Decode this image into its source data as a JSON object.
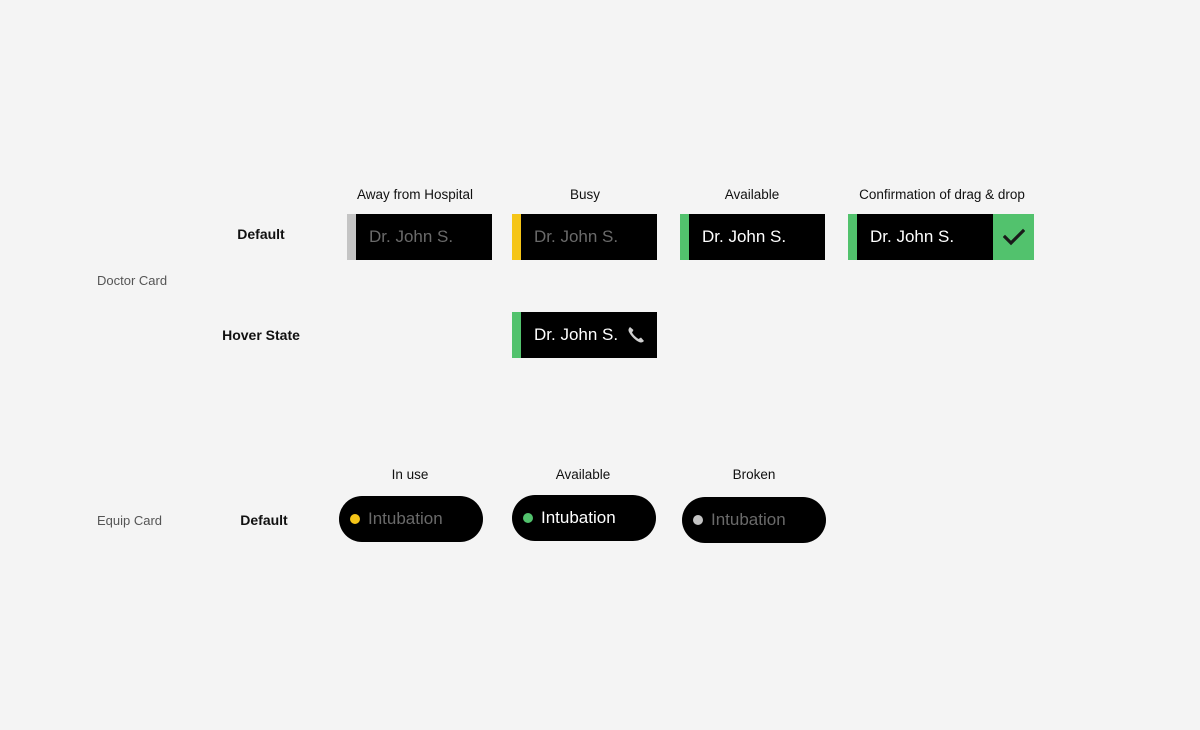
{
  "colors": {
    "background": "#f4f4f4",
    "card": "#000000",
    "away": "#c4c4c4",
    "busy": "#f5c518",
    "available": "#52c26d",
    "broken": "#c4c4c4",
    "muted_text": "#6a6a6a"
  },
  "doctor_section": {
    "label": "Doctor Card",
    "columns": [
      "Away from Hospital",
      "Busy",
      "Available",
      "Confirmation of drag & drop"
    ],
    "rows": {
      "default": "Default",
      "hover": "Hover State"
    },
    "cards": [
      {
        "name": "Dr. John S.",
        "status": "away"
      },
      {
        "name": "Dr. John S.",
        "status": "busy"
      },
      {
        "name": "Dr. John S.",
        "status": "available"
      },
      {
        "name": "Dr. John S.",
        "status": "confirmed",
        "icon": "check-icon"
      }
    ],
    "hover_card": {
      "name": "Dr. John S.",
      "status": "available",
      "icon": "phone-icon"
    }
  },
  "equip_section": {
    "label": "Equip Card",
    "columns": [
      "In use",
      "Available",
      "Broken"
    ],
    "rows": {
      "default": "Default"
    },
    "cards": [
      {
        "name": "Intubation",
        "status": "in-use"
      },
      {
        "name": "Intubation",
        "status": "available"
      },
      {
        "name": "Intubation",
        "status": "broken"
      }
    ]
  }
}
